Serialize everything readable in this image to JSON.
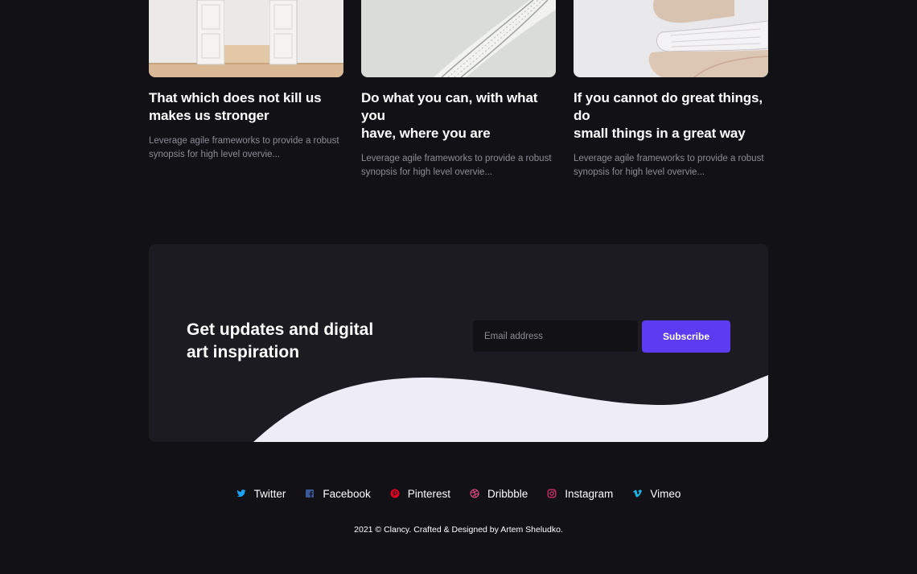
{
  "cards": [
    {
      "title": "That which does not kill us\nmakes us stronger",
      "excerpt": "Leverage agile frameworks to provide a robust\nsynopsis for high level overvie..."
    },
    {
      "title": "Do what you can, with what you\nhave, where you are",
      "excerpt": "Leverage agile frameworks to provide a robust\nsynopsis for high level overvie..."
    },
    {
      "title": "If you cannot do great things, do\nsmall things in a great way",
      "excerpt": "Leverage agile frameworks to provide a robust\nsynopsis for high level overvie..."
    }
  ],
  "newsletter": {
    "title": "Get updates and digital\nart inspiration",
    "email_placeholder": "Email address",
    "subscribe_label": "Subscribe"
  },
  "social": [
    {
      "label": "Twitter",
      "icon": "twitter-icon",
      "color": "#1da1f2"
    },
    {
      "label": "Facebook",
      "icon": "facebook-icon",
      "color": "#3b5998"
    },
    {
      "label": "Pinterest",
      "icon": "pinterest-icon",
      "color": "#e60023"
    },
    {
      "label": "Dribbble",
      "icon": "dribbble-icon",
      "color": "#ea4c89"
    },
    {
      "label": "Instagram",
      "icon": "instagram-icon",
      "color": "#e1306c"
    },
    {
      "label": "Vimeo",
      "icon": "vimeo-icon",
      "color": "#1ab7ea"
    }
  ],
  "footer": {
    "copyright": "2021 © Clancy. Crafted & Designed by Artem Sheludko."
  },
  "colors": {
    "background": "#121116",
    "panel": "#1c1b21",
    "accent": "#5b3cf0",
    "wave": "#eeedf6",
    "muted_text": "#8e8c95"
  }
}
